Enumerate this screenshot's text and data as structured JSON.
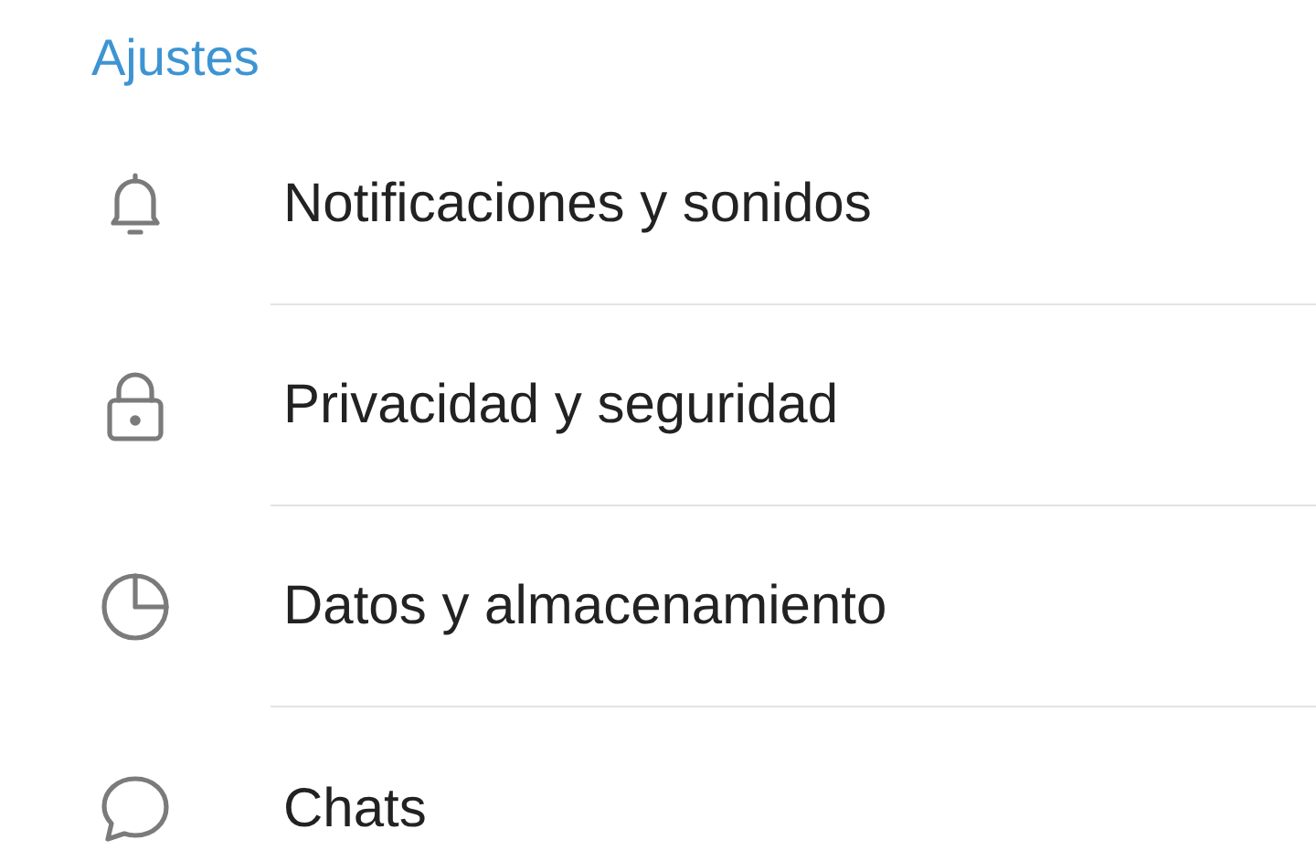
{
  "header": {
    "title": "Ajustes"
  },
  "items": [
    {
      "label": "Notificaciones y sonidos",
      "kind": "bell"
    },
    {
      "label": "Privacidad y seguridad",
      "kind": "lock"
    },
    {
      "label": "Datos y almacenamiento",
      "kind": "pie"
    },
    {
      "label": "Chats",
      "kind": "chat"
    }
  ]
}
